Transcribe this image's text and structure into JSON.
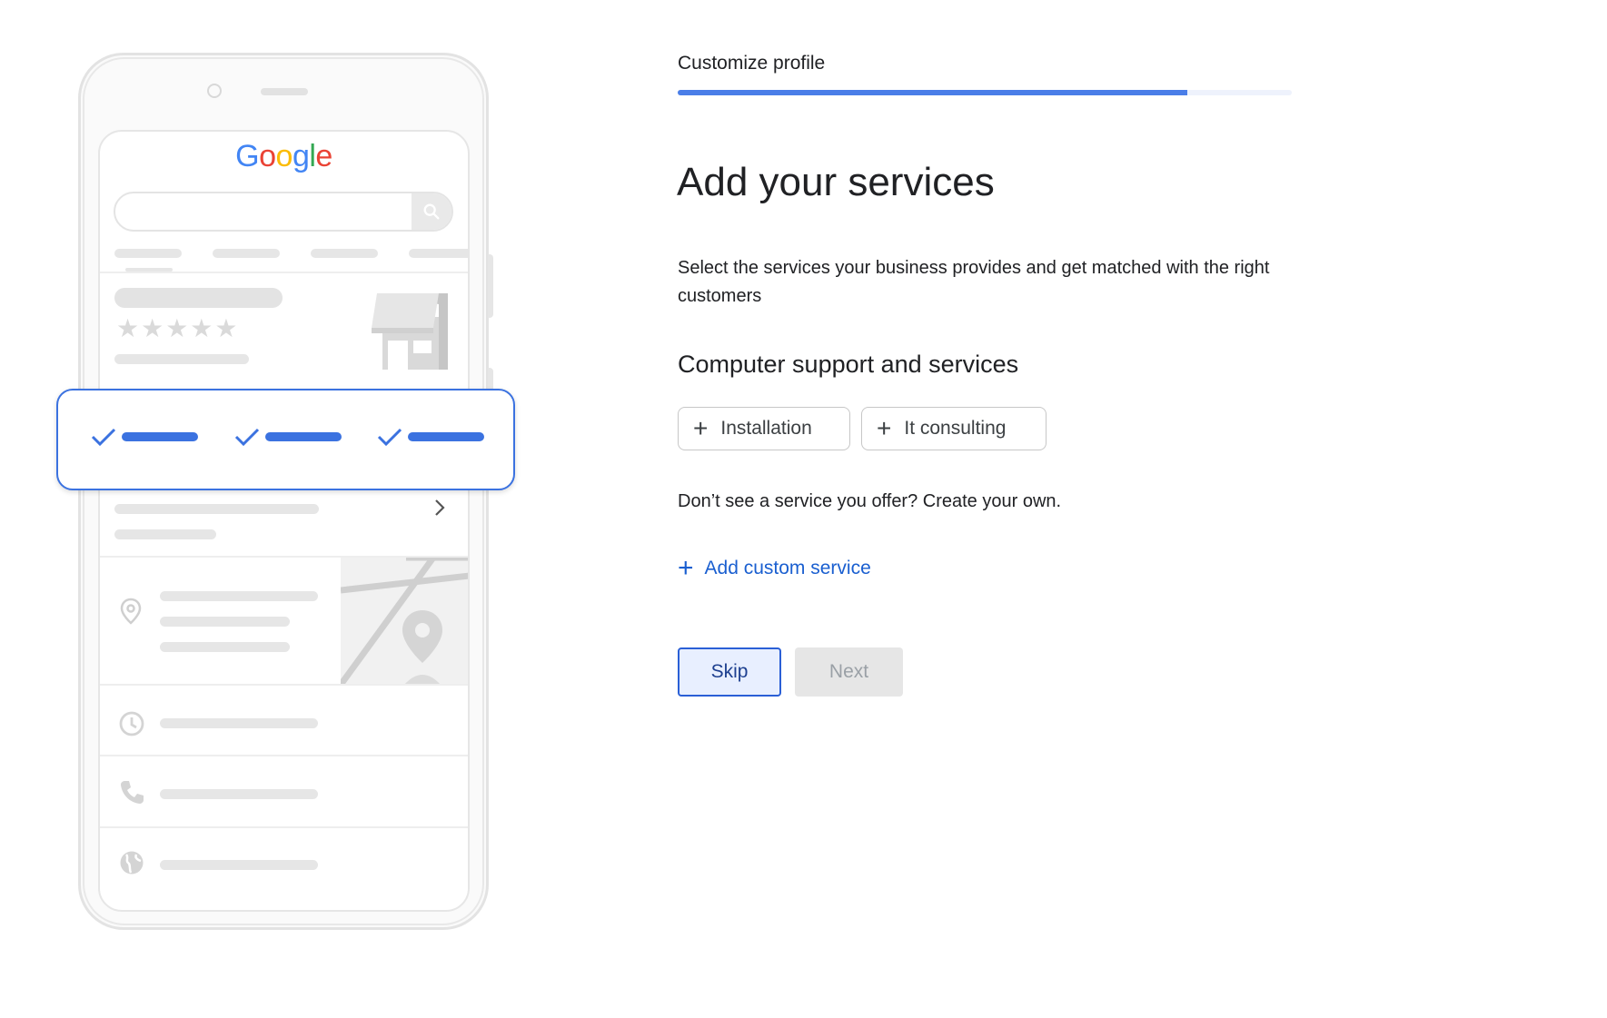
{
  "illustration": {
    "logo_letters": [
      {
        "char": "G",
        "color": "#4285F4"
      },
      {
        "char": "o",
        "color": "#EA4335"
      },
      {
        "char": "o",
        "color": "#FBBC05"
      },
      {
        "char": "g",
        "color": "#4285F4"
      },
      {
        "char": "l",
        "color": "#34A853"
      },
      {
        "char": "e",
        "color": "#EA4335"
      }
    ],
    "rating_stars": "★★★★★",
    "icons": [
      "search-icon",
      "storefront-icon",
      "check-icon",
      "chevron-right-icon",
      "location-pin-icon",
      "map-pin-icon",
      "clock-icon",
      "phone-icon",
      "globe-icon"
    ]
  },
  "header": {
    "step_label": "Customize profile",
    "progress": 0.83
  },
  "main": {
    "title": "Add your services",
    "description": "Select the services your business provides and get matched with the right customers",
    "category_title": "Computer support and services",
    "services": [
      {
        "label": "Installation"
      },
      {
        "label": "It consulting"
      }
    ],
    "custom_prompt": "Don’t see a service you offer? Create your own.",
    "add_custom_label": "Add custom service"
  },
  "actions": {
    "skip_label": "Skip",
    "next_label": "Next"
  },
  "colors": {
    "accent": "#4a7ee8",
    "link": "#1a5fd0",
    "disabled_bg": "#e6e6e6"
  }
}
